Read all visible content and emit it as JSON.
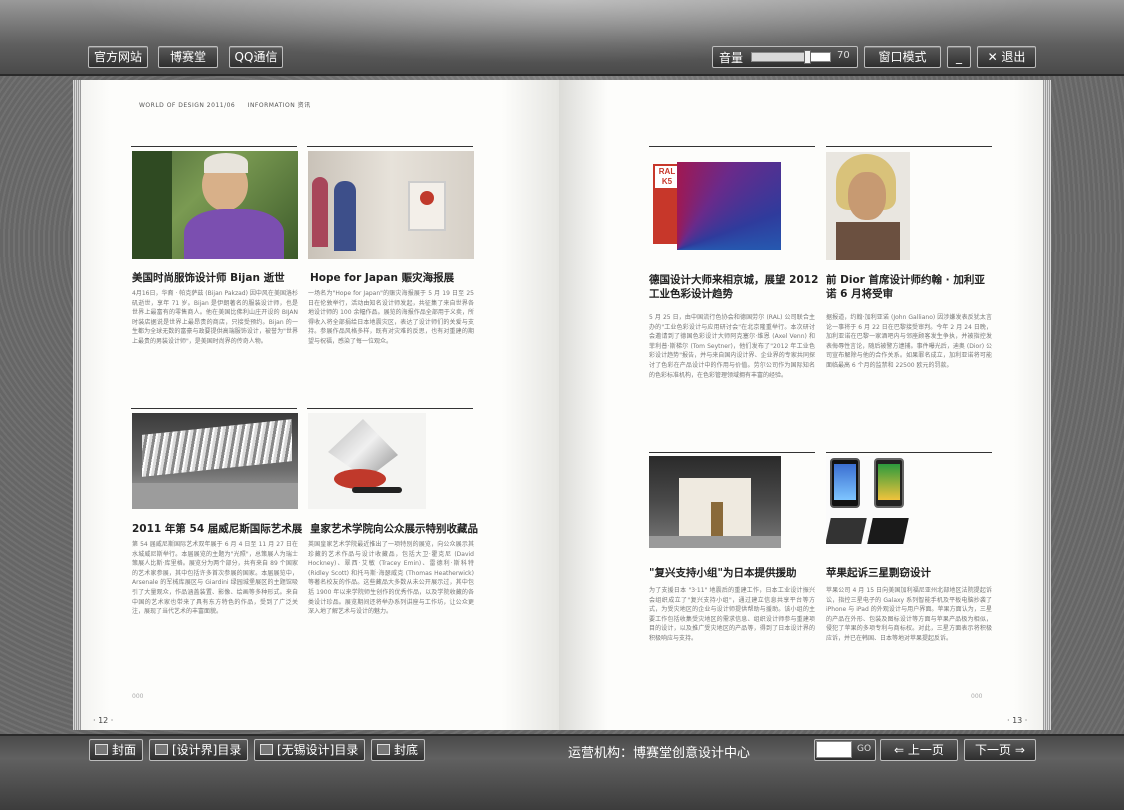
{
  "topbar": {
    "official_site": "官方网站",
    "bosaitang": "博赛堂",
    "qq": "QQ通信",
    "volume_label": "音量",
    "volume_value": "70",
    "volume_level": 0.7,
    "window_mode": "窗口模式",
    "minimize": "_",
    "exit": "✕ 退出"
  },
  "header": {
    "left_a": "WORLD OF DESIGN 2011/06",
    "left_b": "INFORMATION 资讯"
  },
  "left_page": {
    "number": "· 12 ·",
    "folio": "000",
    "articles": [
      {
        "title": "美国时尚服饰设计师 Bijan 逝世",
        "body": "4月16日，华裔 · 帕克萨兹 (Bijan Pakzad) 因中风在美国洛杉矶逝世，享年 71 岁。Bijan 是伊朗著名的服装设计师，也是世界上最富有的零售商人。他在美国比佛利山庄开设的 BIJAN 时装店据说是世界上最昂贵的商店，只接受预约。Bijan 的一生都为全球无数的富豪与政要提供高端服饰设计，被誉为\"世界上最贵的男装设计师\"，是美国时尚界的传奇人物。"
      },
      {
        "title": "Hope for Japan 赈灾海报展",
        "body": "一场名为\"Hope for Japan\"的赈灾海报展于 5 月 19 日至 25 日在伦敦举行，活动由知名设计师发起，共征集了来自世界各地设计师的 100 余幅作品。展览的海报作品全部用于义卖，所得收入将全部捐给日本地震灾区，表达了设计师们的关爱与支持。参展作品风格多样，既有对灾难的反思，也有对重建的期望与祝福，感染了每一位观众。"
      },
      {
        "title": "2011 年第 54 届威尼斯国际艺术展",
        "body": "第 54 届威尼斯国际艺术双年展于 6 月 4 日至 11 月 27 日在水城威尼斯举行。本届展览的主题为\"光照\"，总策展人为瑞士策展人比斯·库里格。展览分为两个部分，共有来自 89 个国家的艺术家参展，其中包括许多首次参展的国家。本届展览中，Arsenale 的军械库展区与 Giardini 绿园城堡展区的主题馆吸引了大量观众，作品涵盖装置、影像、绘画等多种形式。来自中国的艺术家也带来了具有东方特色的作品，受到了广泛关注，展现了当代艺术的丰富面貌。"
      },
      {
        "title": "皇家艺术学院向公众展示特别收藏品",
        "body": "英国皇家艺术学院最近推出了一项特别的展览，向公众展示其珍藏的艺术作品与设计收藏品，包括大卫·霍克尼 (David Hockney)、翠西·艾敏 (Tracey Emin)、雷德利·斯科特 (Ridley Scott) 和托马斯·海瑟威克 (Thomas Heatherwick) 等著名校友的作品。这些藏品大多数从未公开展示过，其中包括 1900 年以来学院师生创作的优秀作品，以及学院收藏的各类设计珍品。展览期间还将举办系列讲座与工作坊，让公众更深入地了解艺术与设计的魅力。"
      }
    ]
  },
  "right_page": {
    "number": "· 13 ·",
    "folio": "000",
    "swatch_label": "RAL K5",
    "articles": [
      {
        "title": "德国设计大师来相京城，展望 2012 工业色彩设计趋势",
        "body": "5 月 25 日，由中国流行色协会和德国劳尔 (RAL) 公司联合主办的\"工业色彩设计与应用研讨会\"在北京隆重举行。本次研讨会邀请到了德国色彩设计大师阿克塞尔·维恩 (Axel Venn) 和菲利普·斯梯尔 (Tom Seytner)，他们发布了\"2012 年工业色彩设计趋势\"报告，并与来自国内设计界、企业界的专家共同探讨了色彩在产品设计中的作用与价值。劳尔公司作为国际知名的色彩标准机构，在色彩管理领域拥有丰富的经验。"
      },
      {
        "title": "前 Dior 首席设计师约翰 · 加利亚诺 6 月将受审",
        "body": "据报道，约翰·加利亚诺 (John Galliano) 因涉嫌发表反犹太言论一事将于 6 月 22 日在巴黎接受审判。今年 2 月 24 日晚，加利亚诺在巴黎一家酒吧内与邻座顾客发生争执，并被指控发表侮辱性言论，随后被警方逮捕。事件曝光后，迪奥 (Dior) 公司宣布解除与他的合作关系。如果罪名成立，加利亚诺将可能面临最高 6 个月的监禁和 22500 欧元的罚款。"
      },
      {
        "title": "\"复兴支持小组\"为日本提供援助",
        "body": "为了支援日本 \"3·11\" 地震后的重建工作，日本工业设计振兴会组织成立了\"复兴支持小组\"，通过建立信息共享平台等方式，为受灾地区的企业与设计师提供帮助与援助。该小组的主要工作包括收集受灾地区的需求信息、组织设计师参与重建项目的设计，以及推广受灾地区的产品等，得到了日本设计界的积极响应与支持。"
      },
      {
        "title": "苹果起诉三星剽窃设计",
        "body": "苹果公司 4 月 15 日向美国加利福尼亚州北部地区法院提起诉讼，指控三星电子的 Galaxy 系列智能手机及平板电脑抄袭了 iPhone 与 iPad 的外观设计与用户界面。苹果方面认为，三星的产品在外形、包装及图标设计等方面与苹果产品极为相似，侵犯了苹果的多项专利与商标权。对此，三星方面表示将积极应诉，并已在韩国、日本等地对苹果提起反诉。"
      }
    ]
  },
  "bottombar": {
    "cover": "封面",
    "toc_design_world": "[设计界]目录",
    "toc_wuxi_design": "[无锡设计]目录",
    "back_cover": "封底",
    "operator": "运营机构：博赛堂创意设计中心",
    "go": "GO",
    "prev": "上一页",
    "next": "下一页"
  },
  "colors": {
    "accent_red": "#c0392b",
    "button_border": "#bdbdbd"
  }
}
